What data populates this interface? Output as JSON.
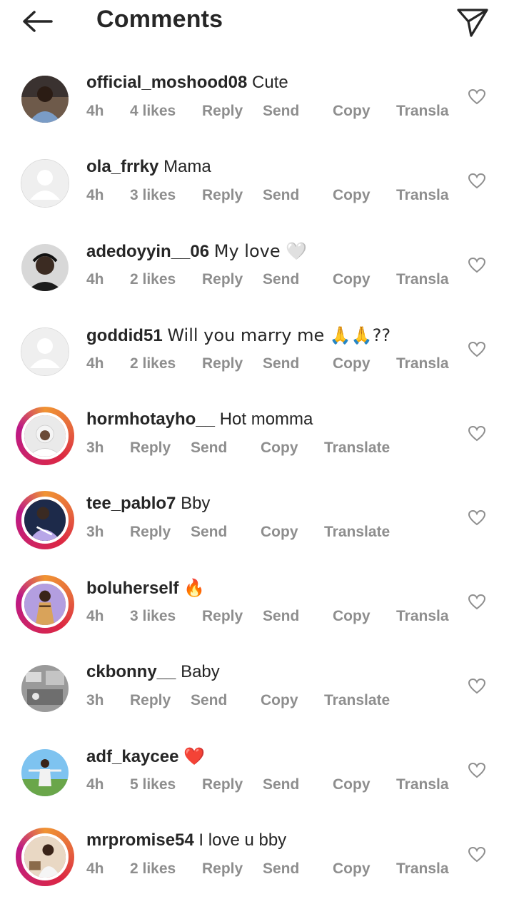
{
  "header": {
    "title": "Comments",
    "back_icon": "arrow-left-icon",
    "send_icon": "paper-plane-icon"
  },
  "actions": {
    "reply": "Reply",
    "send": "Send",
    "copy": "Copy",
    "translate_full": "Translate",
    "translate_trunc": "Transla"
  },
  "comments": [
    {
      "username": "official_moshood08",
      "text": "Cute",
      "time": "4h",
      "likes": "4 likes"
    },
    {
      "username": "ola_frrky",
      "text": "Mama",
      "time": "4h",
      "likes": "3 likes"
    },
    {
      "username": "adedoyyin__06",
      "text": "My love 🤍",
      "time": "4h",
      "likes": "2 likes"
    },
    {
      "username": "goddid51",
      "text": "Will you marry me 🙏🙏??",
      "time": "4h",
      "likes": "2 likes"
    },
    {
      "username": "hormhotayho__",
      "text": "Hot momma",
      "time": "3h",
      "likes": ""
    },
    {
      "username": "tee_pablo7",
      "text": "Bby",
      "time": "3h",
      "likes": ""
    },
    {
      "username": "boluherself",
      "text": "🔥",
      "time": "4h",
      "likes": "3 likes"
    },
    {
      "username": "ckbonny__",
      "text": "Baby",
      "time": "3h",
      "likes": ""
    },
    {
      "username": "adf_kaycee",
      "text": "❤️",
      "time": "4h",
      "likes": "5 likes"
    },
    {
      "username": "mrpromise54",
      "text": "I love u bby",
      "time": "4h",
      "likes": "2 likes"
    }
  ],
  "colors": {
    "text": "#262626",
    "meta": "#8e8e8e",
    "divider": "#dbdbdb",
    "story_ring": "#dc2743"
  }
}
